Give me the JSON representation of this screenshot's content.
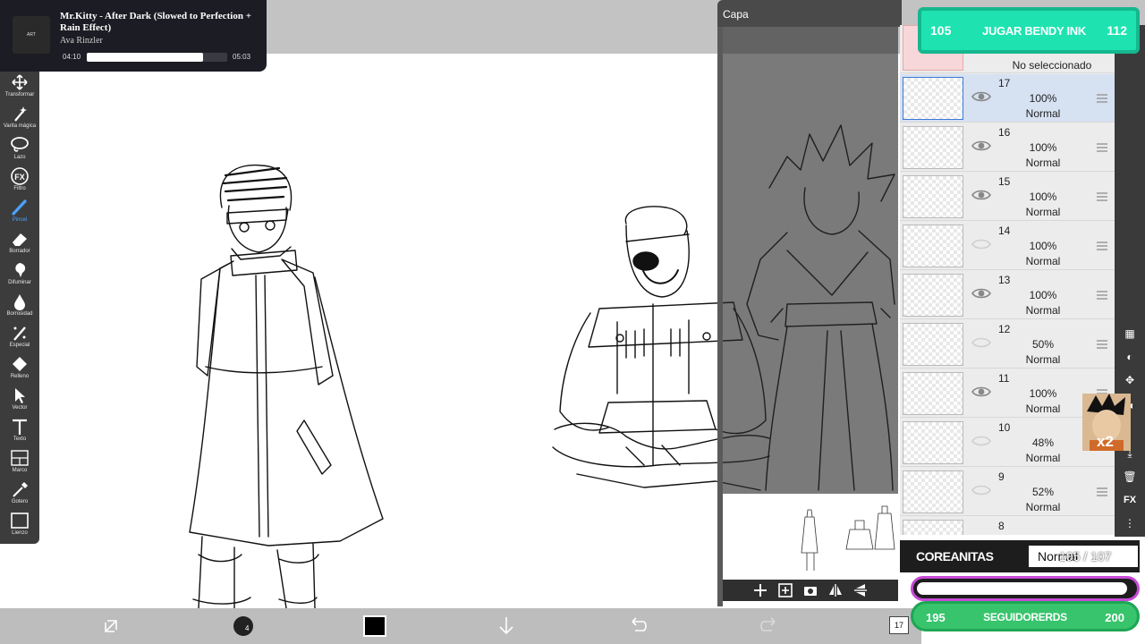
{
  "music": {
    "title": "Mr.Kitty - After Dark (Slowed to Perfection + Rain Effect)",
    "artist": "Ava Rinzler",
    "current_time": "04:10",
    "total_time": "05:03",
    "progress": 0.825
  },
  "toolbar": {
    "items": [
      {
        "label": "Transformar",
        "icon": "move-icon"
      },
      {
        "label": "Varita mágica",
        "icon": "magic-wand-icon"
      },
      {
        "label": "Lazo",
        "icon": "lasso-icon"
      },
      {
        "label": "Filtro",
        "icon": "fx-icon"
      },
      {
        "label": "Pincel",
        "icon": "brush-icon"
      },
      {
        "label": "Borrador",
        "icon": "eraser-icon"
      },
      {
        "label": "Difuminar",
        "icon": "smudge-icon"
      },
      {
        "label": "Borrosidad",
        "icon": "blur-icon"
      },
      {
        "label": "Especial",
        "icon": "special-icon"
      },
      {
        "label": "Relleno",
        "icon": "fill-icon"
      },
      {
        "label": "Vector",
        "icon": "vector-icon"
      },
      {
        "label": "Texto",
        "icon": "text-icon"
      },
      {
        "label": "Marco",
        "icon": "frame-icon"
      },
      {
        "label": "Gotero",
        "icon": "eyedropper-icon"
      },
      {
        "label": "Lienzo",
        "icon": "canvas-icon"
      }
    ],
    "active": "Pincel"
  },
  "panel": {
    "title": "Capa",
    "unselected_label": "No seleccionado"
  },
  "layers": [
    {
      "number": "17",
      "opacity": "100%",
      "blend": "Normal",
      "visible": true,
      "selected": true
    },
    {
      "number": "16",
      "opacity": "100%",
      "blend": "Normal",
      "visible": true,
      "selected": false
    },
    {
      "number": "15",
      "opacity": "100%",
      "blend": "Normal",
      "visible": true,
      "selected": false
    },
    {
      "number": "14",
      "opacity": "100%",
      "blend": "Normal",
      "visible": false,
      "selected": false
    },
    {
      "number": "13",
      "opacity": "100%",
      "blend": "Normal",
      "visible": true,
      "selected": false
    },
    {
      "number": "12",
      "opacity": "50%",
      "blend": "Normal",
      "visible": false,
      "selected": false
    },
    {
      "number": "11",
      "opacity": "100%",
      "blend": "Normal",
      "visible": true,
      "selected": false
    },
    {
      "number": "10",
      "opacity": "48%",
      "blend": "Normal",
      "visible": false,
      "selected": false
    },
    {
      "number": "9",
      "opacity": "52%",
      "blend": "Normal",
      "visible": false,
      "selected": false
    },
    {
      "number": "8",
      "opacity": "",
      "blend": "",
      "visible": false,
      "selected": false
    }
  ],
  "bottom": {
    "layer_count": "17"
  },
  "overlays": {
    "jugar": {
      "left": "105",
      "text": "JUGAR BENDY INK",
      "right": "112"
    },
    "corea": {
      "name": "COREANITAS",
      "box_text": "Normal",
      "count": "105 / 107"
    },
    "seguidores": {
      "left": "195",
      "text": "SEGUIDORERDS",
      "right": "200",
      "fill": 0.97
    },
    "avatar_badge": "x2"
  },
  "colors": {
    "panel_dark": "#3a3a3a",
    "selected_layer": "#d6e1f2",
    "jugar_bg": "#1ee3b1",
    "seguidores_bg": "#37c46c",
    "pbar_border": "#c64ad6",
    "active_tool": "#4aa3ff"
  }
}
